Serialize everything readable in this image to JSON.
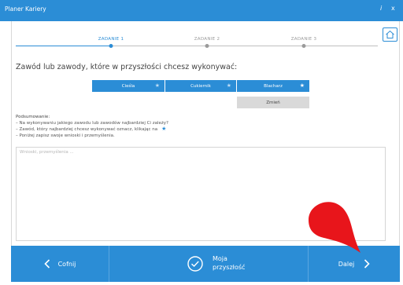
{
  "window": {
    "title": "Planer Kariery",
    "info_icon": "i",
    "close_icon": "x"
  },
  "stepper": {
    "steps": [
      {
        "label": "ZADANIE 1",
        "active": true
      },
      {
        "label": "ZADANIE 2",
        "active": false
      },
      {
        "label": "ZADANIE 3",
        "active": false
      }
    ]
  },
  "main": {
    "heading": "Zawód lub zawody, które w przyszłości chcesz wykonywać:",
    "jobs": [
      {
        "label": "Cieśla",
        "starred": false
      },
      {
        "label": "Cukiernik",
        "starred": false
      },
      {
        "label": "Blacharz",
        "starred": true
      }
    ],
    "change_label": "Zmień",
    "summary": {
      "title": "Podsumowanie:",
      "line1": "– Na wykonywaniu jakiego zawodu lub zawodów najbardziej Ci zależy?",
      "line2": "– Zawód, który najbardziej chcesz wykonywać oznacz, klikając na",
      "line3": "– Poniżej zapisz swoje wnioski i przemyślenia."
    },
    "notes_placeholder": "Wnioski, przemyślenia ..."
  },
  "footer": {
    "back_label": "Cofnij",
    "future_label_line1": "Moja",
    "future_label_line2": "przyszłość",
    "next_label": "Dalej"
  },
  "colors": {
    "accent": "#2b8dd6",
    "pointer": "#e8151b"
  }
}
